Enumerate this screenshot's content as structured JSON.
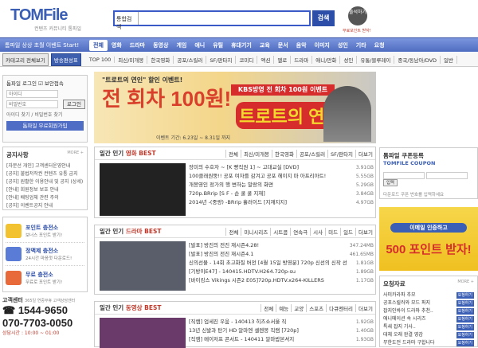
{
  "header": {
    "logo_main": "TOMFile",
    "tagline": "컨텐츠 커뮤니티 톰파일",
    "search_type": "통합검색",
    "search_value": "",
    "search_button": "검색",
    "stamp_label": "출석하기",
    "stamp_caption": "무료포인트 받자!"
  },
  "nav": {
    "promo": "톰파일 상상 초월 이벤트 Start!",
    "items": [
      "전체",
      "영화",
      "드라마",
      "동영상",
      "게임",
      "애니",
      "유틸",
      "휴대기기",
      "교육",
      "문서",
      "음악",
      "이미지",
      "성인",
      "기타",
      "요청"
    ]
  },
  "subnav": {
    "btn1": "카테고리 전체보기",
    "btn2": "방송편성표",
    "items": [
      "TOP 100",
      "최신/미개봉",
      "한국영화",
      "공포/스릴러",
      "SF/판타지",
      "코미디",
      "액션",
      "멜로",
      "드라마",
      "애니/만화",
      "성인",
      "유통/블루레이",
      "중국/동남아/DVD",
      "일반"
    ]
  },
  "login": {
    "label": "톰파일 로그인",
    "keep": "보안접속",
    "id_ph": "아이디",
    "pw_ph": "비밀번호",
    "login_btn": "로그인",
    "find": "아이디 찾기 / 비밀번호 찾기",
    "join": "톰파일 무료회원가입"
  },
  "notice": {
    "title": "공지사항",
    "more": "MORE +",
    "items": [
      "[자분선 개인] 고객센터운영안내",
      "[공지] 불법저작권 컨텐츠 유통 금지",
      "[공지] 원활한 이용안내 및 공지 (상세)",
      "[안내] 회원정보 보호 안내",
      "[안내] 배팅업체 관련 주의",
      "[공지] 이벤트공지 안내"
    ]
  },
  "charge": {
    "items": [
      {
        "title": "포인트 충전소",
        "desc": "보너스 포인트 받기!"
      },
      {
        "title": "정액제 충전소",
        "desc": "24시간 마음껏 다운로드!"
      },
      {
        "title": "무료 충전소",
        "desc": "무료로 포인트 받기!"
      }
    ]
  },
  "cs": {
    "title": "고객센터",
    "hours": "365일 연중무휴 고객상담센터",
    "phone1": "1544-9650",
    "phone2": "070-7703-0050",
    "time": "상담시간 : 10:00 ~ 01:00"
  },
  "banner": {
    "h1": "\"트로트의 연인\" 할인 이벤트!",
    "h2": "전 회차 100원!",
    "red": "KBS방영 전 회차 100원 이벤트",
    "title": "트로트의 연인",
    "period": "이벤트 기간: 6.23일 ~ 8.31일 까지"
  },
  "movie": {
    "title_pre": "일간 인기 ",
    "title_hl": "영화 BEST",
    "tabs": [
      "전체",
      "최신/미개봉",
      "한국영화",
      "공포/스릴러",
      "SF/판타지",
      "더보기"
    ],
    "rows": [
      {
        "t": "장미의 수호자 ~ [K 빵직원 1] ~ 고대교실 [DVD]",
        "s": "3.91GB"
      },
      {
        "t": "100클래원뚱!! 공포 여자를 감겨고 공포 헤이지 마 아프리아트!",
        "s": "5.55GB"
      },
      {
        "t": "개봉영인 정가의 행 변하는 말랑의 화면",
        "s": "5.29GB"
      },
      {
        "t": "720p.BRrip [S F - 순 쿨 쿨 지재]",
        "s": "3.84GB"
      },
      {
        "t": "2014년 -(중량) -BRrip 흘러이드 [지재지지]",
        "s": "4.97GB"
      }
    ]
  },
  "drama": {
    "title_pre": "일간 인기 ",
    "title_hl": "드라마 BEST",
    "tabs": [
      "전체",
      "미니시리즈",
      "시트콤",
      "연속극",
      "시사",
      "미드",
      "일드",
      "더보기"
    ],
    "rows": [
      {
        "t": "[발표] 방진의 전진 재시즌4.28!",
        "s": "347.24MB"
      },
      {
        "t": "[발표] 방진의 전진 재시즌4.1",
        "s": "461.65MB"
      },
      {
        "t": "신의선물 - 14회 초고화질 버전 [4월 15일 방영분] 720p 신선의 신작 선",
        "s": "1.81GB"
      },
      {
        "t": "[기방이E47] - 140415.HDTV.H264.720p-su",
        "s": "1.89GB"
      },
      {
        "t": "[바이킹스 Vikings 시즌2 E05]720p.HDTV.x264-KILLERS",
        "s": "1.17GB"
      }
    ]
  },
  "video": {
    "title_pre": "일간 인기 ",
    "title_hl": "동영상 BEST",
    "tabs": [
      "전체",
      "예능",
      "교양",
      "스포츠",
      "다큐멘터리",
      "더보기"
    ],
    "rows": [
      {
        "t": "[직캠] 업세진 우움 - 140413 히즈쇼서울 직",
        "s": "1.92GB"
      },
      {
        "t": "13년 신발과 탄기 HD 알마엔 셀렌봉 직캠 [720p]",
        "s": "1.40GB"
      },
      {
        "t": "[직캠] 메이저프 콘서트 - 140411 알마밥본셔지",
        "s": "1.93GB"
      }
    ]
  },
  "coupon": {
    "title": "톰파일 쿠폰등록",
    "subtitle": "TOMFILE COUPON",
    "ph": "",
    "btn": "입력",
    "note": "다운로드 쿠폰 번호를 입력하세요"
  },
  "event": {
    "e1": "이메일 인증하고",
    "e2": "500 포인트 받자!"
  },
  "request": {
    "title": "요청자료",
    "more": "MORE +",
    "items": [
      "사미카라파 추모",
      "공포스릴러와 모드 퍼지",
      "잡지인바이 드라마 추천..",
      "애니메이션 속 시리즈",
      "특새 잡지 기사..",
      "대체 오래 완결 영감",
      "무한도전 드라마 구합니다"
    ],
    "badge": "요청하기"
  }
}
